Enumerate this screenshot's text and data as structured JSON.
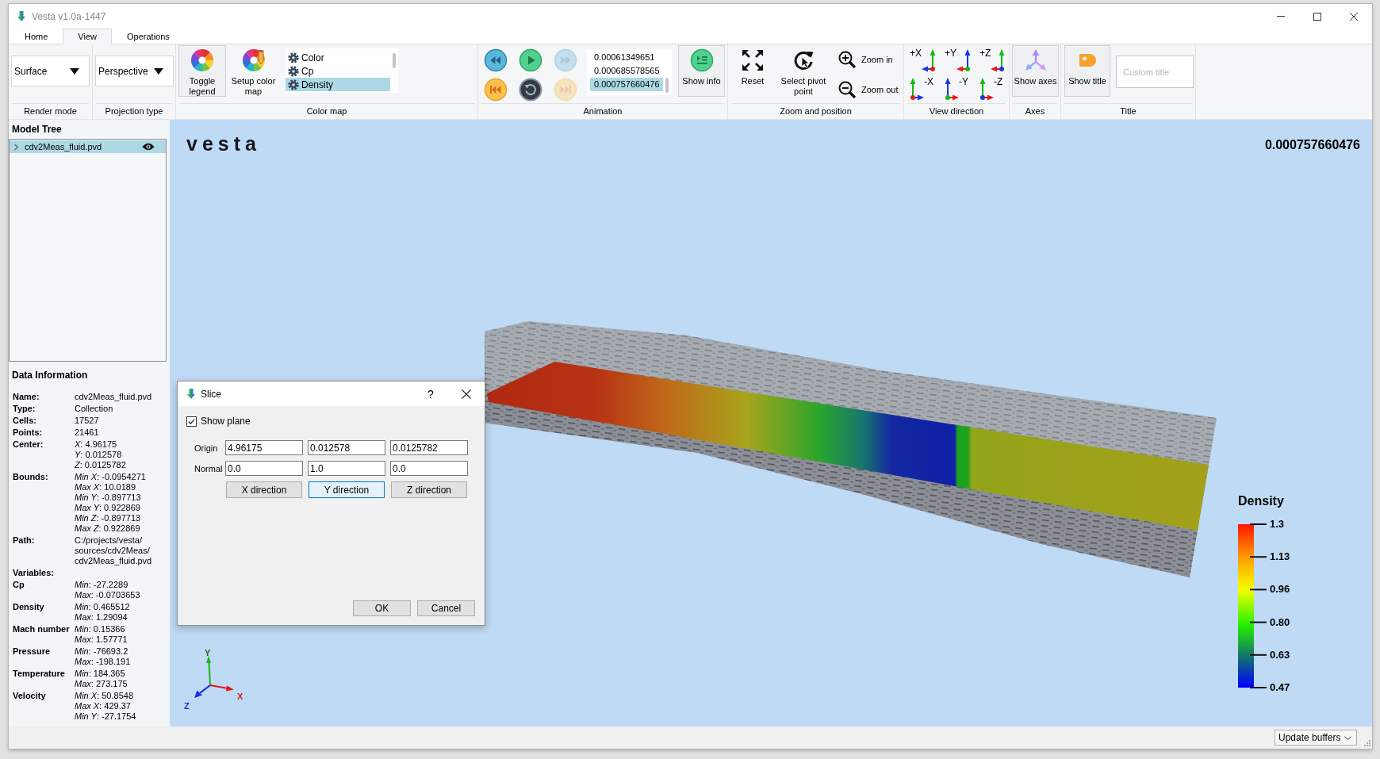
{
  "window": {
    "title": "Vesta v1.0a-1447"
  },
  "tabs": [
    {
      "label": "Home",
      "selected": false
    },
    {
      "label": "View",
      "selected": true
    },
    {
      "label": "Operations",
      "selected": false
    }
  ],
  "ribbon": {
    "render_mode": {
      "value": "Surface",
      "label": "Render mode"
    },
    "projection_type": {
      "value": "Perspective",
      "label": "Projection type"
    },
    "color_map": {
      "buttons": [
        {
          "label": "Toggle legend",
          "pressed": true
        },
        {
          "label": "Setup color map",
          "pressed": false
        }
      ],
      "items": [
        {
          "label": "Color",
          "selected": false
        },
        {
          "label": "Cp",
          "selected": false
        },
        {
          "label": "Density",
          "selected": true
        }
      ],
      "label": "Color map"
    },
    "animation": {
      "controls": [
        {
          "disabled": false
        },
        {
          "disabled": false
        },
        {
          "disabled": true
        },
        {
          "disabled": false
        },
        {
          "disabled": false
        },
        {
          "disabled": true
        }
      ],
      "times": [
        {
          "label": "0.00061349651",
          "selected": false
        },
        {
          "label": "0.000685578565",
          "selected": false
        },
        {
          "label": "0.000757660476",
          "selected": true
        }
      ],
      "show_info": {
        "label": "Show info",
        "pressed": true
      },
      "label": "Animation"
    },
    "zoom_and_position": {
      "buttons": [
        {
          "label": "Reset"
        },
        {
          "label": "Select pivot point"
        },
        {
          "label": "Zoom in"
        },
        {
          "label": "Zoom out"
        }
      ],
      "label": "Zoom and position"
    },
    "view_direction": {
      "buttons": [
        {
          "label": "+X"
        },
        {
          "label": "+Y"
        },
        {
          "label": "+Z"
        },
        {
          "label": "-X"
        },
        {
          "label": "-Y"
        },
        {
          "label": "-Z"
        }
      ],
      "label": "View direction"
    },
    "axes": {
      "button": {
        "label": "Show axes",
        "pressed": true
      },
      "label": "Axes"
    },
    "title": {
      "button": {
        "label": "Show title",
        "pressed": true
      },
      "placeholder": "Custom title",
      "label": "Title"
    }
  },
  "model_tree": {
    "title": "Model Tree",
    "items": [
      {
        "label": "cdv2Meas_fluid.pvd",
        "selected": true,
        "expanded": false,
        "visible": true
      }
    ]
  },
  "data_information": {
    "title": "Data Information",
    "rows": [
      {
        "key": "Name:",
        "values": [
          "cdv2Meas_fluid.pvd"
        ]
      },
      {
        "key": "Type:",
        "values": [
          "Collection"
        ]
      },
      {
        "key": "Cells:",
        "values": [
          "17527"
        ]
      },
      {
        "key": "Points:",
        "values": [
          "21461"
        ]
      },
      {
        "key": "Center:",
        "values": [
          "*X*: 4.96175",
          "*Y*: 0.012578",
          "*Z*: 0.0125782"
        ]
      },
      {
        "key": "Bounds:",
        "values": [
          "*Min X*: -0.0954271",
          "*Max X*: 10.0189",
          "*Min Y*: -0.897713",
          "*Max Y*: 0.922869",
          "*Min Z*: -0.897713",
          "*Max Z*: 0.922869"
        ]
      },
      {
        "key": "Path:",
        "values": [
          "C:/projects/vesta/",
          "sources/cdv2Meas/",
          "cdv2Meas_fluid.pvd"
        ]
      },
      {
        "key": "Variables:"
      },
      {
        "key": "Cp",
        "values": [
          "*Min*: -27.2289",
          "*Max*: -0.0703653"
        ]
      },
      {
        "key": "Density",
        "values": [
          "*Min*: 0.465512",
          "*Max*: 1.29094"
        ]
      },
      {
        "key": "Mach number",
        "values": [
          "*Min*: 0.15366",
          "*Max*: 1.57771"
        ]
      },
      {
        "key": "Pressure",
        "values": [
          "*Min*: -76693.2",
          "*Max*: -198.191"
        ]
      },
      {
        "key": "Temperature",
        "values": [
          "*Min*: 184.365",
          "*Max*: 273.175"
        ]
      },
      {
        "key": "Velocity",
        "values": [
          "*Min X*: 50.8548",
          "*Max X*: 429.37",
          "*Min Y*: -27.1754"
        ]
      }
    ]
  },
  "viewport": {
    "logo": "vesta",
    "time": "0.000757660476",
    "legend": {
      "title": "Density",
      "ticks": [
        "1.3",
        "1.13",
        "0.96",
        "0.80",
        "0.63",
        "0.47"
      ]
    },
    "axis_labels": [
      "Y",
      "X",
      "Z"
    ]
  },
  "dialog": {
    "title": "Slice",
    "help": "?",
    "show_plane": {
      "label": "Show plane",
      "checked": true
    },
    "rows": [
      {
        "label": "Origin",
        "values": [
          "4.96175",
          "0.012578",
          "0.0125782"
        ]
      },
      {
        "label": "Normal",
        "values": [
          "0.0",
          "1.0",
          "0.0"
        ]
      }
    ],
    "direction_buttons": [
      {
        "label": "X direction",
        "focused": false
      },
      {
        "label": "Y direction",
        "focused": true
      },
      {
        "label": "Z direction",
        "focused": false
      }
    ],
    "buttons": [
      "OK",
      "Cancel"
    ]
  },
  "status_bar": {
    "dropdown": "Update buffers"
  }
}
